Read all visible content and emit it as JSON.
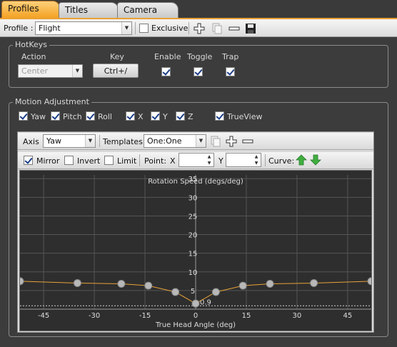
{
  "tabs": [
    {
      "label": "Profiles",
      "active": true
    },
    {
      "label": "Titles",
      "active": false
    },
    {
      "label": "Camera",
      "active": false
    }
  ],
  "profile_bar": {
    "label": "Profile :",
    "selected": "Flight",
    "exclusive_label": "Exclusive",
    "exclusive_checked": false,
    "icons": [
      "add-icon",
      "copy-icon",
      "remove-icon",
      "save-icon"
    ]
  },
  "hotkeys": {
    "title": "HotKeys",
    "headers": {
      "action": "Action",
      "key": "Key",
      "enable": "Enable",
      "toggle": "Toggle",
      "trap": "Trap"
    },
    "action_value": "Center",
    "key_value": "Ctrl+/",
    "enable": true,
    "toggle": true,
    "trap": true
  },
  "motion": {
    "title": "Motion Adjustment",
    "axes": [
      {
        "label": "Yaw",
        "checked": true
      },
      {
        "label": "Pitch",
        "checked": true
      },
      {
        "label": "Roll",
        "checked": true
      },
      {
        "label": "X",
        "checked": true
      },
      {
        "label": "Y",
        "checked": true
      },
      {
        "label": "Z",
        "checked": true
      },
      {
        "label": "TrueView",
        "checked": true
      }
    ]
  },
  "editor": {
    "axis_label": "Axis",
    "axis_value": "Yaw",
    "templates_label": "Templates",
    "templates_value": "One:One",
    "mirror_label": "Mirror",
    "mirror": true,
    "invert_label": "Invert",
    "invert": false,
    "limit_label": "Limit",
    "limit": false,
    "point_label": "Point:",
    "x_label": "X",
    "x_value": "",
    "y_label": "Y",
    "y_value": "",
    "curve_label": "Curve:",
    "colors": {
      "curve": "#e8a23a",
      "point": "#b8b8b8",
      "grid": "#555555",
      "up": "#3fae3f",
      "down": "#3fae3f"
    }
  },
  "chart_data": {
    "type": "line",
    "ylabel": "Rotation Speed (degs/deg)",
    "xlabel": "True Head Angle (deg)",
    "xlim": [
      -52,
      52
    ],
    "ylim": [
      0,
      36
    ],
    "xticks": [
      -45,
      -30,
      -15,
      0,
      15,
      30,
      45
    ],
    "yticks": [
      5,
      10,
      15,
      20,
      25,
      30,
      35
    ],
    "grid": true,
    "threshold_label": "0.9",
    "threshold": 0.9,
    "series": [
      {
        "x": [
          -52,
          -35,
          -22,
          -14,
          -6,
          0,
          6,
          14,
          22,
          35,
          52
        ],
        "y": [
          7.5,
          7.0,
          6.8,
          6.3,
          4.6,
          1.5,
          4.6,
          6.3,
          6.8,
          7.0,
          7.5
        ]
      }
    ]
  }
}
